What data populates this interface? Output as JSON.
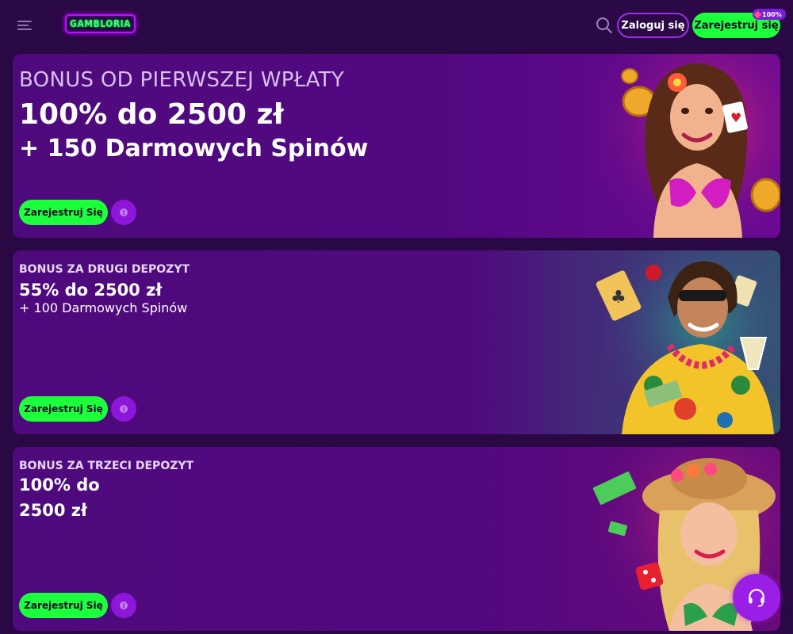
{
  "header": {
    "logo_text": "GAMBLORIA",
    "login_label": "Zaloguj się",
    "register_label": "Zarejestruj się",
    "register_badge": "100%"
  },
  "cards": [
    {
      "subtitle": "BONUS OD PIERWSZEJ WPŁATY",
      "title": "100% do 2500 zł",
      "extra": "+ 150 Darmowych Spinów",
      "button_label": "Zarejestruj Się",
      "info_icon": "info-icon"
    },
    {
      "subtitle": "BONUS ZA DRUGI DEPOZYT",
      "title": "55% do 2500 zł",
      "extra": "+ 100 Darmowych Spinów",
      "button_label": "Zarejestruj Się",
      "info_icon": "info-icon"
    },
    {
      "subtitle": "BONUS ZA TRZECI DEPOZYT",
      "title": "100% do 2500 zł",
      "button_label": "Zarejestruj Się",
      "info_icon": "info-icon"
    }
  ],
  "icons": {
    "menu": "hamburger-menu-icon",
    "search": "search-icon",
    "support": "headset-icon"
  },
  "colors": {
    "accent_green": "#1cff3c",
    "accent_purple": "#8d16d8",
    "background": "#2a0844"
  }
}
